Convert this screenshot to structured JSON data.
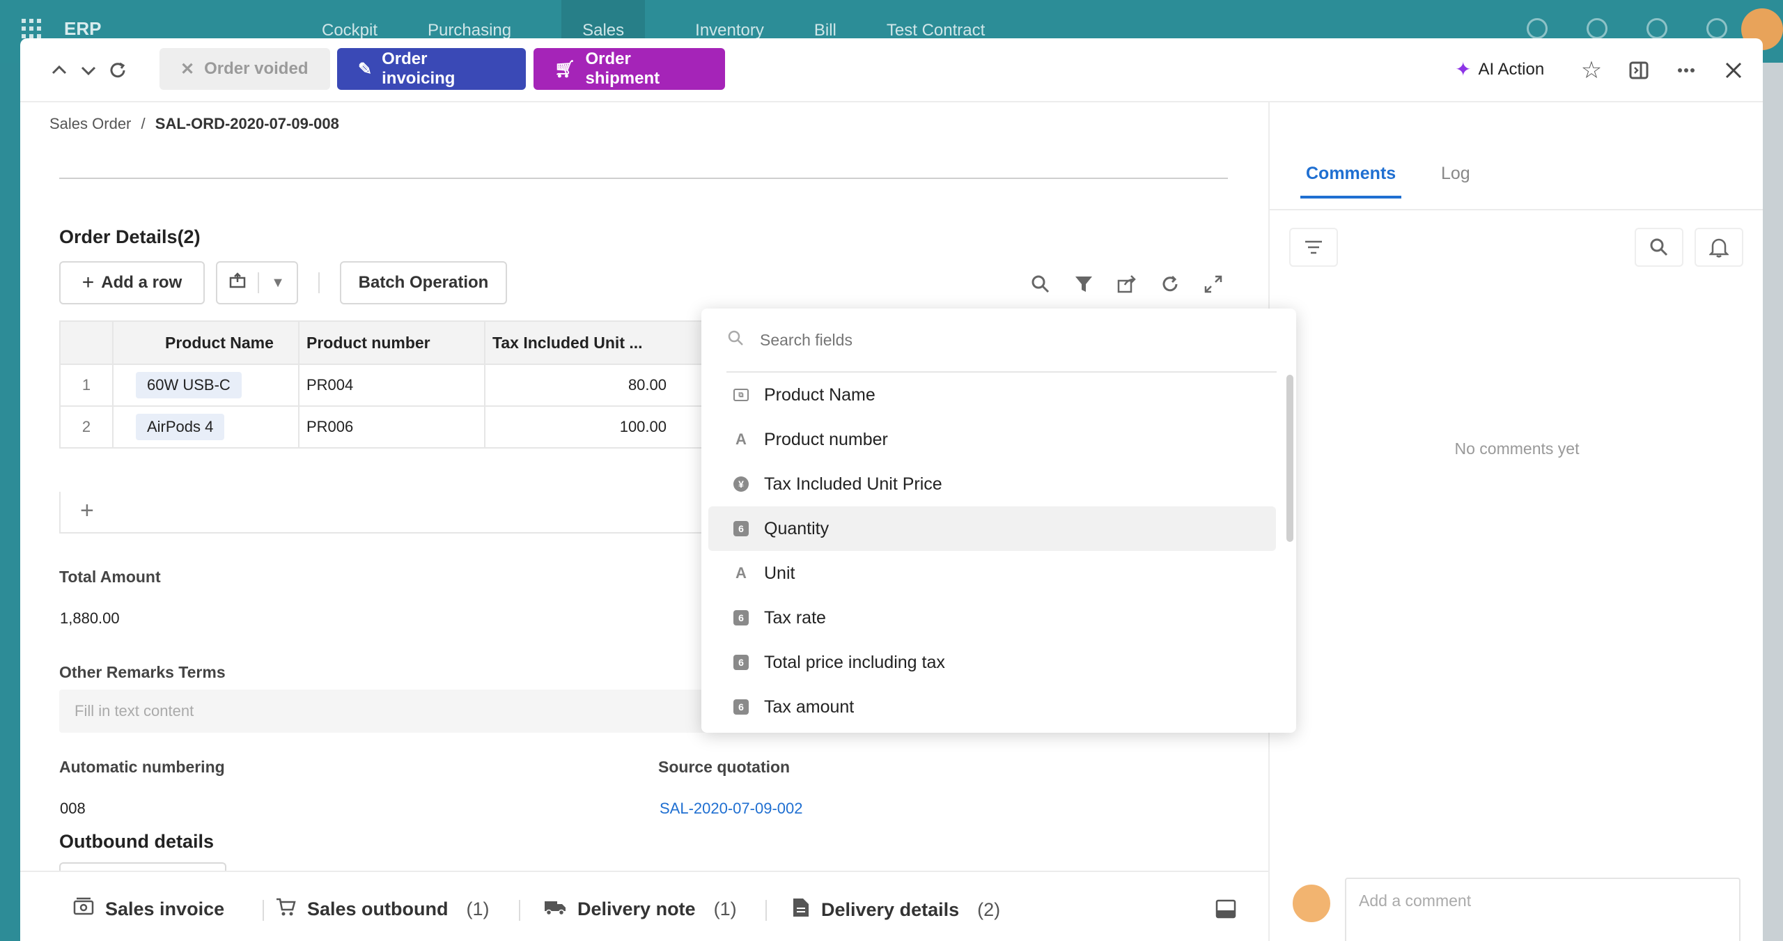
{
  "appbar": {
    "brand": "ERP",
    "nav": [
      "Cockpit",
      "Purchasing",
      "Sales",
      "Inventory",
      "Bill",
      "Test Contract"
    ]
  },
  "toolbar": {
    "void_label": "Order voided",
    "invoice_label": "Order invoicing",
    "shipment_label": "Order shipment",
    "ai_label": "AI Action"
  },
  "breadcrumb": {
    "parent": "Sales Order",
    "separator": "/",
    "current": "SAL-ORD-2020-07-09-008"
  },
  "order_details": {
    "title": "Order Details(2)",
    "add_row_label": "Add a row",
    "batch_label": "Batch Operation",
    "columns": [
      "Product Name",
      "Product number",
      "Tax Included Unit ..."
    ],
    "rows": [
      {
        "index": "1",
        "name": "60W USB-C",
        "number": "PR004",
        "price": "80.00"
      },
      {
        "index": "2",
        "name": "AirPods 4",
        "number": "PR006",
        "price": "100.00"
      }
    ]
  },
  "total_amount": {
    "label": "Total Amount",
    "value": "1,880.00"
  },
  "remarks": {
    "label": "Other Remarks Terms",
    "placeholder": "Fill in text content"
  },
  "auto_numbering": {
    "label": "Automatic numbering",
    "value": "008"
  },
  "source_quotation": {
    "label": "Source quotation",
    "value": "SAL-2020-07-09-002"
  },
  "outbound": {
    "title": "Outbound details"
  },
  "bottom_tabs": [
    {
      "label": "Sales invoice",
      "count": ""
    },
    {
      "label": "Sales outbound",
      "count": "(1)"
    },
    {
      "label": "Delivery note",
      "count": "(1)"
    },
    {
      "label": "Delivery details",
      "count": "(2)"
    }
  ],
  "right_panel": {
    "tab_comments": "Comments",
    "tab_log": "Log",
    "empty_text": "No comments yet",
    "comment_placeholder": "Add a comment"
  },
  "field_dropdown": {
    "search_placeholder": "Search fields",
    "items": [
      {
        "label": "Product Name",
        "type": "link"
      },
      {
        "label": "Product number",
        "type": "text"
      },
      {
        "label": "Tax Included Unit Price",
        "type": "currency"
      },
      {
        "label": "Quantity",
        "type": "number"
      },
      {
        "label": "Unit",
        "type": "text"
      },
      {
        "label": "Tax rate",
        "type": "number"
      },
      {
        "label": "Total price including tax",
        "type": "number"
      },
      {
        "label": "Tax amount",
        "type": "number"
      }
    ]
  },
  "colors": {
    "accent_blue": "#3a49b6",
    "accent_purple": "#a524b8",
    "link_blue": "#1f6fd1",
    "appbar_teal": "#2c8d97"
  }
}
